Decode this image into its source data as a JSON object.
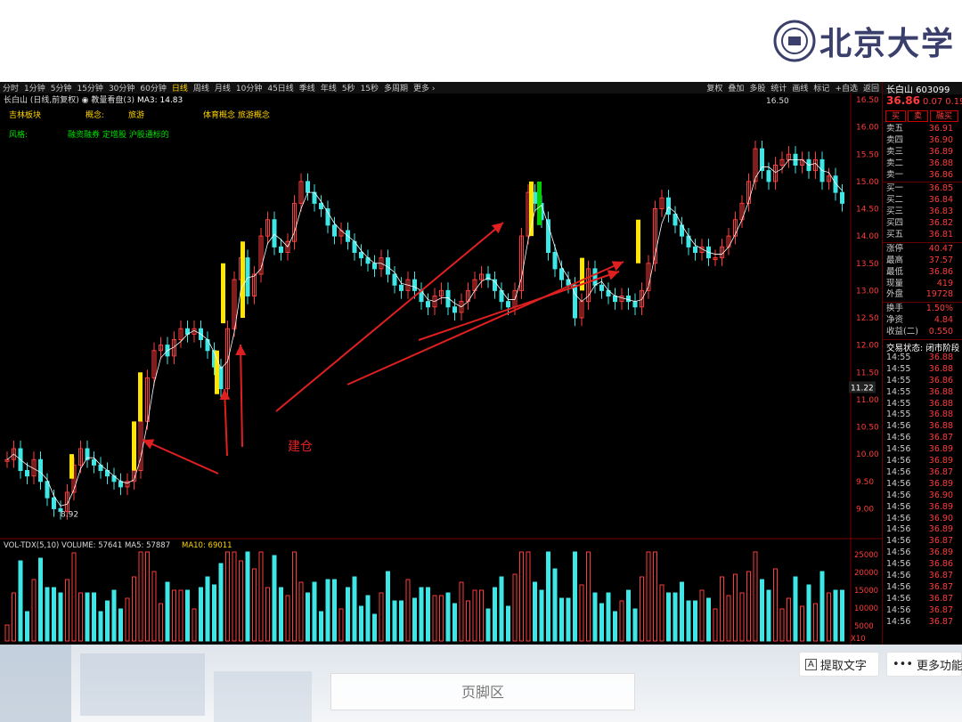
{
  "logo": {
    "text": "北京大学"
  },
  "toolbar": {
    "periods": [
      "分时",
      "1分钟",
      "5分钟",
      "15分钟",
      "30分钟",
      "60分钟",
      "日线",
      "周线",
      "月线",
      "10分钟",
      "45日线",
      "季线",
      "年线",
      "5秒",
      "15秒",
      "多周期",
      "更多 ›"
    ],
    "active": "日线",
    "right": [
      "复权",
      "叠加",
      "多股",
      "统计",
      "画线",
      "标记",
      "+自选",
      "返回"
    ]
  },
  "info": {
    "line": "长白山 (日线,前复权) ◉ 教量看盘(3)",
    "ma": "MA3: 14.83"
  },
  "concepts": {
    "row1": [
      "吉林板块",
      "概念:",
      "旅游",
      "体育概念  旅游概念"
    ],
    "row2": [
      "风格:",
      "融资融券  定增股  沪股通标的"
    ]
  },
  "annotation": {
    "label": "建仓",
    "high": "16.50",
    "low": "8.92"
  },
  "price_axis": [
    "16.50",
    "16.00",
    "15.50",
    "15.00",
    "14.50",
    "14.00",
    "13.50",
    "13.00",
    "12.50",
    "12.00",
    "11.50",
    "11.00",
    "10.50",
    "10.00",
    "9.50",
    "9.00"
  ],
  "current_tag": "11.22",
  "volume": {
    "title": "VOL-TDX(5,10)  VOLUME: 57641  MA5: 57887",
    "ma10": "MA10: 69011",
    "axis": [
      "25000",
      "20000",
      "15000",
      "10000",
      "5000"
    ],
    "unit": "X10"
  },
  "panel": {
    "name": "长白山 603099",
    "price": "36.86",
    "change": "0.07",
    "pct": "0.19%",
    "buttons": [
      "买",
      "卖",
      "融买"
    ],
    "asks": [
      [
        "卖五",
        "36.91"
      ],
      [
        "卖四",
        "36.90"
      ],
      [
        "卖三",
        "36.89"
      ],
      [
        "卖二",
        "36.88"
      ],
      [
        "卖一",
        "36.86"
      ]
    ],
    "bids": [
      [
        "买一",
        "36.85"
      ],
      [
        "买二",
        "36.84"
      ],
      [
        "买三",
        "36.83"
      ],
      [
        "买四",
        "36.82"
      ],
      [
        "买五",
        "36.81"
      ]
    ],
    "stats": [
      [
        "涨停",
        "40.47"
      ],
      [
        "最高",
        "37.57"
      ],
      [
        "最低",
        "36.86"
      ],
      [
        "现量",
        "419"
      ],
      [
        "外盘",
        "19728"
      ]
    ],
    "stats2": [
      [
        "换手",
        "1.50%"
      ],
      [
        "净资",
        "4.84"
      ],
      [
        "收益(二)",
        "0.550"
      ]
    ],
    "status": "交易状态: 闭市阶段",
    "ticks": [
      [
        "14:55",
        "36.88"
      ],
      [
        "14:55",
        "36.88"
      ],
      [
        "14:55",
        "36.86"
      ],
      [
        "14:55",
        "36.88"
      ],
      [
        "14:55",
        "36.88"
      ],
      [
        "14:55",
        "36.88"
      ],
      [
        "14:56",
        "36.88"
      ],
      [
        "14:56",
        "36.87"
      ],
      [
        "14:56",
        "36.89"
      ],
      [
        "14:56",
        "36.89"
      ],
      [
        "14:56",
        "36.87"
      ],
      [
        "14:56",
        "36.89"
      ],
      [
        "14:56",
        "36.90"
      ],
      [
        "14:56",
        "36.89"
      ],
      [
        "14:56",
        "36.90"
      ],
      [
        "14:56",
        "36.89"
      ],
      [
        "14:56",
        "36.87"
      ],
      [
        "14:56",
        "36.89"
      ],
      [
        "14:56",
        "36.86"
      ],
      [
        "14:56",
        "36.87"
      ],
      [
        "14:56",
        "36.87"
      ],
      [
        "14:56",
        "36.87"
      ],
      [
        "14:56",
        "36.87"
      ],
      [
        "14:56",
        "36.87"
      ]
    ]
  },
  "footer": {
    "label": "页脚区"
  },
  "actions": {
    "extract": "提取文字",
    "more": "更多功能"
  },
  "colors": {
    "up": "#ff3b3b",
    "down": "#3ee6e6",
    "highlight": "#ffe600",
    "green": "#00d000",
    "arrow": "#e02020"
  }
}
